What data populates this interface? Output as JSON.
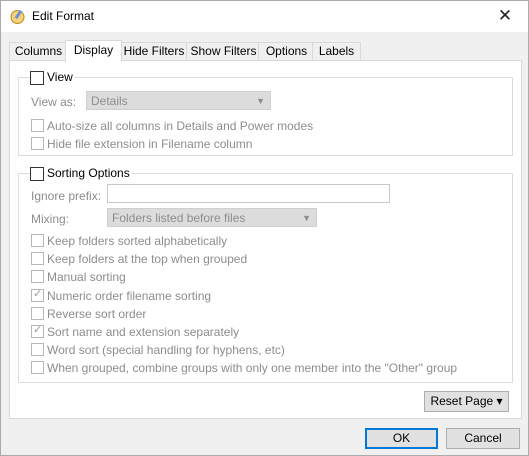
{
  "window": {
    "title": "Edit Format",
    "close_label": "✕"
  },
  "tabs": [
    {
      "label": "Columns"
    },
    {
      "label": "Display"
    },
    {
      "label": "Hide Filters"
    },
    {
      "label": "Show Filters"
    },
    {
      "label": "Options"
    },
    {
      "label": "Labels"
    }
  ],
  "view_group": {
    "title": "View",
    "view_as_label": "View as:",
    "view_as_value": "Details",
    "options": [
      {
        "label": "Auto-size all columns in Details and Power modes",
        "checked": false
      },
      {
        "label": "Hide file extension in Filename column",
        "checked": false
      }
    ]
  },
  "sorting_group": {
    "title": "Sorting Options",
    "ignore_prefix_label": "Ignore prefix:",
    "ignore_prefix_value": "",
    "mixing_label": "Mixing:",
    "mixing_value": "Folders listed before files",
    "options": [
      {
        "label": "Keep folders sorted alphabetically",
        "checked": false
      },
      {
        "label": "Keep folders at the top when grouped",
        "checked": false
      },
      {
        "label": "Manual sorting",
        "checked": false
      },
      {
        "label": "Numeric order filename sorting",
        "checked": true
      },
      {
        "label": "Reverse sort order",
        "checked": false
      },
      {
        "label": "Sort name and extension separately",
        "checked": true
      },
      {
        "label": "Word sort (special handling for hyphens, etc)",
        "checked": false
      },
      {
        "label": "When grouped, combine groups with only one member into the \"Other\" group",
        "checked": false
      }
    ]
  },
  "buttons": {
    "reset_page": "Reset Page ▾",
    "ok": "OK",
    "cancel": "Cancel"
  },
  "icons": {
    "app": "edit-format-icon",
    "close": "close-icon",
    "check": "checkmark-icon",
    "chevron": "chevron-down-icon"
  },
  "colors": {
    "default_button_border": "#0078d7",
    "disabled_text": "#8d8d8d"
  }
}
